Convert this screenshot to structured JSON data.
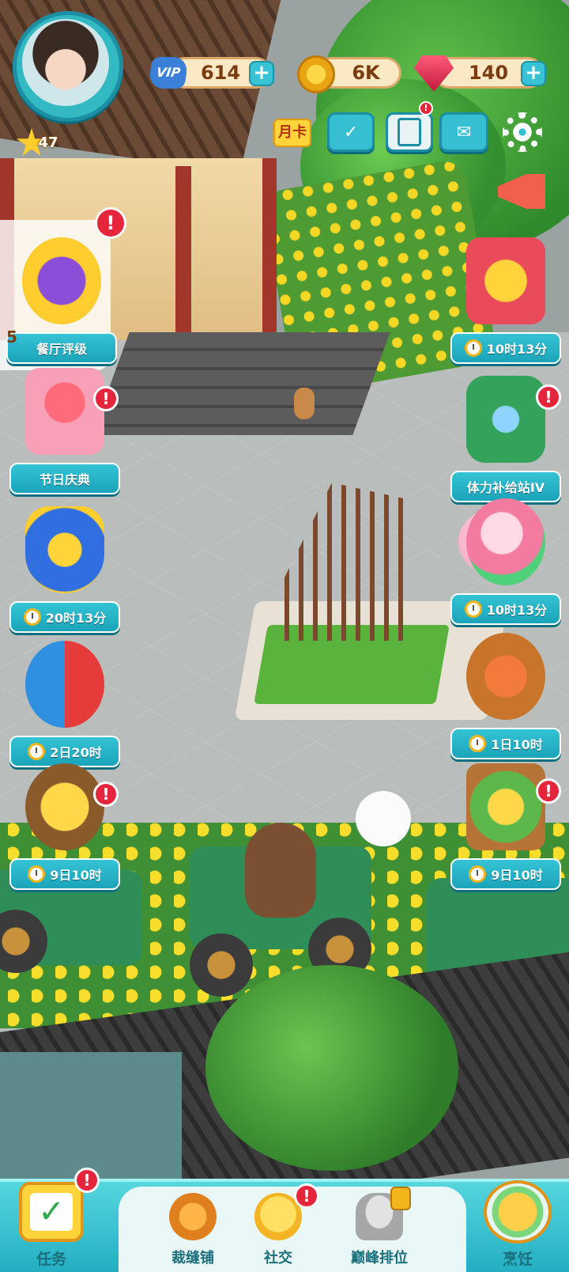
{
  "player": {
    "level": "47",
    "resources": {
      "vip_label": "VIP",
      "vip_points": "614",
      "coins": "6K",
      "gems": "140"
    }
  },
  "toolbar": {
    "monthly_card_label": "月卡"
  },
  "left_events": [
    {
      "label": "餐厅评级",
      "art": "restaurant-rating"
    },
    {
      "label": "节日庆典",
      "art": "gift-box"
    },
    {
      "timer": "20时13分",
      "art": "crown-shield"
    },
    {
      "timer": "2日20时",
      "art": "rock-paper-scissors"
    },
    {
      "timer": "9日10时",
      "art": "wheat-basket"
    }
  ],
  "left_side_number": "5",
  "right_events": [
    {
      "timer": "10时13分",
      "art": "treasure-chest"
    },
    {
      "label": "体力补给站IV",
      "art": "vending-machine"
    },
    {
      "timer": "10时13分",
      "art": "piggy-bank"
    },
    {
      "timer": "1日10时",
      "art": "fruit-basket"
    },
    {
      "timer": "9日10时",
      "art": "vegetable-crate"
    }
  ],
  "bottom_nav": {
    "tasks": "任务",
    "tailor": "裁缝铺",
    "social": "社交",
    "ranking": "巅峰排位",
    "cooking": "烹饪"
  },
  "colors": {
    "accent_teal": "#1ba4ba",
    "alert_red": "#e5253c",
    "resource_text": "#7b3c12"
  }
}
